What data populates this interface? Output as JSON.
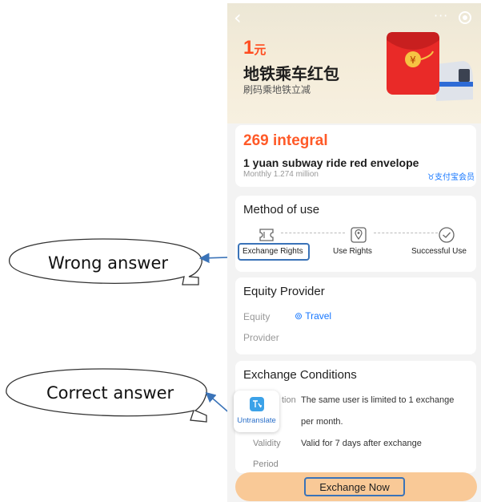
{
  "hero": {
    "amount": "1",
    "unit": "元",
    "title": "地铁乘车红包",
    "subtitle": "刷码乘地铁立减"
  },
  "points_card": {
    "value": "269 integral",
    "description": "1 yuan subway ride red envelope",
    "monthly": "Monthly 1.274 million",
    "badge": "支付宝会员"
  },
  "method": {
    "title": "Method of use",
    "steps": [
      {
        "label": "Exchange Rights",
        "icon": "ticket-icon"
      },
      {
        "label": "Use Rights",
        "icon": "location-pin-icon"
      },
      {
        "label": "Successful Use",
        "icon": "check-circle-icon"
      }
    ]
  },
  "provider": {
    "title": "Equity Provider",
    "key_line1": "Equity",
    "key_line2": "Provider",
    "value": "Travel"
  },
  "exchange": {
    "title": "Exchange Conditions",
    "condition_key_fragment": "tion",
    "condition_text_line1": "The same user is limited to 1 exchange",
    "condition_text_line2": "per month.",
    "validity_key": "Validity",
    "validity_key_line2": "Period",
    "validity_text": "Valid for 7 days after exchange"
  },
  "float_app": {
    "label": "Untranslate",
    "icon": "translate-app-icon"
  },
  "cta": {
    "label": "Exchange Now"
  },
  "annotations": {
    "wrong": "Wrong answer",
    "correct": "Correct answer"
  },
  "colors": {
    "accent_orange": "#ff5a28",
    "link_blue": "#1677ff",
    "annotation_blue": "#3a73b8",
    "cta_bg": "#f9c997"
  }
}
